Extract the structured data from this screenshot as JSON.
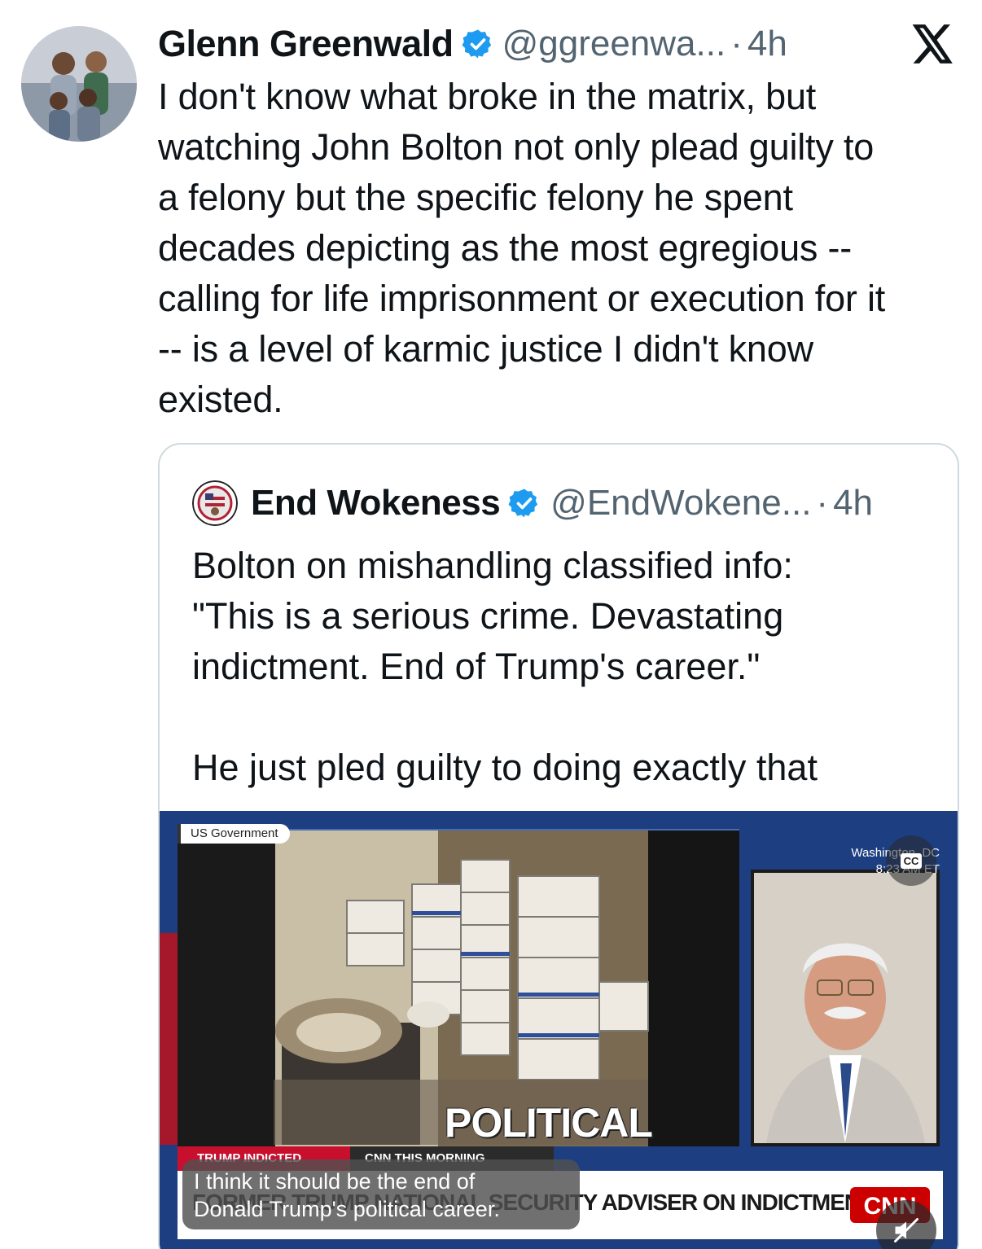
{
  "tweet": {
    "author_name": "Glenn Greenwald",
    "handle": "@ggreenwa...",
    "separator": "·",
    "time": "4h",
    "body_lines": [
      "I don't know what broke in the matrix, but",
      "watching John Bolton not only plead guilty to",
      "a felony but the specific felony he spent",
      "decades depicting as the most egregious --",
      "calling for life imprisonment or execution for it",
      "-- is a level of karmic justice I didn't know",
      "existed."
    ]
  },
  "quoted": {
    "author_name": "End Wokeness",
    "handle": "@EndWokene...",
    "separator": "·",
    "time": "4h",
    "body_lines": [
      "Bolton on mishandling classified info:",
      "\"This is a serious crime. Devastating",
      "indictment. End of Trump's career.\""
    ],
    "body_lines_2": [
      "He just pled guilty to doing exactly that"
    ]
  },
  "video": {
    "source_label": "US Government",
    "location": "Washington, DC",
    "clock": "8:23 AM ET",
    "cc_label": "CC",
    "overlay_word": "POLITICAL",
    "lower_tag_red": "TRUMP INDICTED",
    "lower_tag_dark": "CNN THIS MORNING",
    "headline": "FORMER TRUMP NATIONAL SECURITY ADVISER ON INDICTMENT",
    "network": "CNN",
    "caption_lines": [
      "I think it should be the end of",
      "Donald Trump's political career."
    ]
  },
  "colors": {
    "verified_blue": "#1d9bf0",
    "handle_gray": "#536471",
    "cnn_red": "#cc0000",
    "border": "#cfd9de"
  }
}
